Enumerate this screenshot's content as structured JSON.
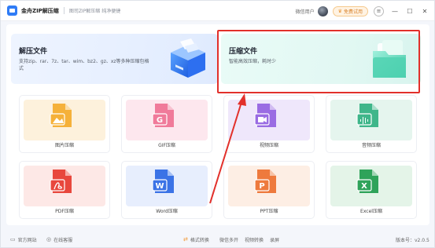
{
  "titlebar": {
    "app_name": "金舟ZIP解压缩",
    "slogan": "图司ZIP解压缩 纯净便捷",
    "user_name": "微信用户",
    "trial_label": "免费试用",
    "menu_icon": "menu-icon",
    "minimize_icon": "minimize-icon",
    "maximize_icon": "maximize-icon",
    "close_icon": "close-icon"
  },
  "hero": {
    "decompress": {
      "title": "解压文件",
      "desc": "支持zip、rar、7z、tar、wim、bz2、gz、xz等多种压缩包格式"
    },
    "compress": {
      "title": "压缩文件",
      "desc": "智能高效压缩，耗时少"
    }
  },
  "cards": [
    {
      "label": "图片压缩",
      "bg": "#fdf1dc",
      "icon_color": "#f5b13a",
      "icon": "image-icon"
    },
    {
      "label": "GIF压缩",
      "bg": "#fde7ee",
      "icon_color": "#f07a9a",
      "icon": "gif-icon",
      "glyph": "G"
    },
    {
      "label": "视频压缩",
      "bg": "#efe7fb",
      "icon_color": "#9a6ce3",
      "icon": "video-icon"
    },
    {
      "label": "音频压缩",
      "bg": "#e5f5ee",
      "icon_color": "#3fb68a",
      "icon": "audio-icon"
    },
    {
      "label": "PDF压缩",
      "bg": "#fde8e6",
      "icon_color": "#e8473d",
      "icon": "pdf-icon"
    },
    {
      "label": "Word压缩",
      "bg": "#e7eefd",
      "icon_color": "#3b73e6",
      "icon": "word-icon",
      "glyph": "W"
    },
    {
      "label": "PPT压缩",
      "bg": "#fdeee4",
      "icon_color": "#ee7a3d",
      "icon": "ppt-icon",
      "glyph": "P"
    },
    {
      "label": "Excel压缩",
      "bg": "#e4f4e8",
      "icon_color": "#2fa35a",
      "icon": "excel-icon",
      "glyph": "X"
    }
  ],
  "footer": {
    "website": "官方网站",
    "support": "在线客服",
    "links": [
      "格式转换",
      "微信多开",
      "视频转换",
      "录屏"
    ],
    "version": "版本号：v2.0.5"
  },
  "colors": {
    "accent": "#2f7cf6",
    "highlight": "#e2302b"
  }
}
